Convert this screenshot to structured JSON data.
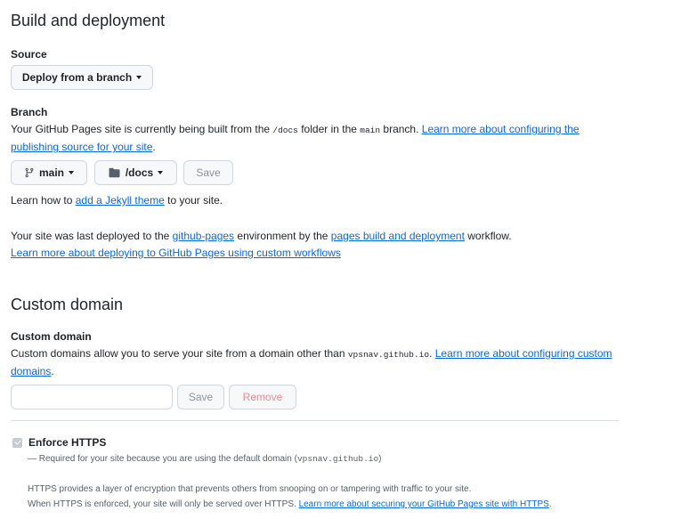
{
  "build": {
    "heading": "Build and deployment",
    "source_label": "Source",
    "source_dropdown": "Deploy from a branch",
    "branch_label": "Branch",
    "branch_desc_1": "Your GitHub Pages site is currently being built from the ",
    "branch_desc_folder": "/docs",
    "branch_desc_2": " folder in the ",
    "branch_desc_branch": "main",
    "branch_desc_3": " branch. ",
    "branch_link": "Learn more about configuring the publishing source for your site",
    "branch_link_end": ".",
    "branch_button": "main",
    "folder_button": "/docs",
    "save_button": "Save",
    "jekyll_prefix": "Learn how to ",
    "jekyll_link": "add a Jekyll theme",
    "jekyll_suffix": " to your site.",
    "deployed_1": "Your site was last deployed to the ",
    "deployed_env_link": "github-pages",
    "deployed_2": " environment by the ",
    "deployed_workflow_link": "pages build and deployment",
    "deployed_3": " workflow.",
    "custom_workflows_link": "Learn more about deploying to GitHub Pages using custom workflows"
  },
  "custom_domain": {
    "heading": "Custom domain",
    "label": "Custom domain",
    "desc_1": "Custom domains allow you to serve your site from a domain other than ",
    "desc_domain": "vpsnav.github.io",
    "desc_2": ". ",
    "desc_link": "Learn more about configuring custom domains",
    "desc_end": ".",
    "input_value": "",
    "input_placeholder": "",
    "save_button": "Save",
    "remove_button": "Remove"
  },
  "https": {
    "enforce_label": "Enforce HTTPS",
    "checked": true,
    "required_note_1": "— Required for your site because you are using the default domain (",
    "required_note_domain": "vpsnav.github.io",
    "required_note_2": ")",
    "info_1": "HTTPS provides a layer of encryption that prevents others from snooping on or tampering with traffic to your site.",
    "info_2": "When HTTPS is enforced, your site will only be served over HTTPS. ",
    "info_link": "Learn more about securing your GitHub Pages site with HTTPS",
    "info_end": "."
  },
  "icons": {
    "branch": "git-branch-icon",
    "folder": "folder-icon",
    "caret": "caret-down-icon",
    "checkbox": "checkbox-checked-icon"
  },
  "colors": {
    "link": "#0969da",
    "text": "#1f2328",
    "muted": "#57606a",
    "border": "#d0d7de",
    "danger_disabled": "#f08a8f"
  }
}
